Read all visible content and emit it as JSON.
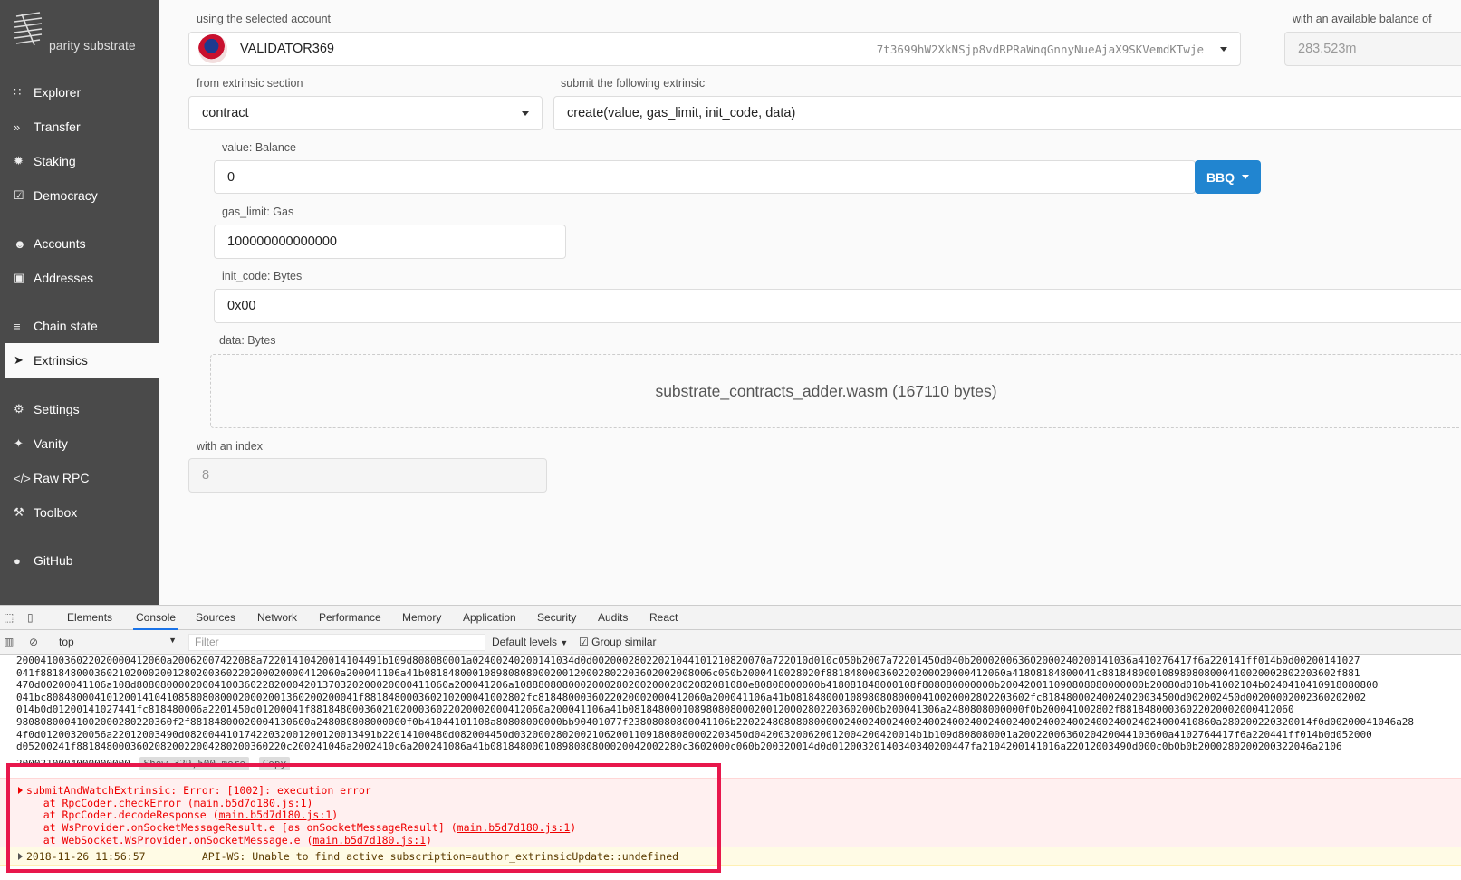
{
  "sidebar": {
    "logo_text": "parity substrate",
    "items": [
      {
        "label": "Explorer",
        "icon": "grid-icon"
      },
      {
        "label": "Transfer",
        "icon": "double-chevron-icon"
      },
      {
        "label": "Staking",
        "icon": "certificate-icon"
      },
      {
        "label": "Democracy",
        "icon": "calendar-check-icon"
      },
      {
        "label": "Accounts",
        "icon": "users-icon"
      },
      {
        "label": "Addresses",
        "icon": "address-book-icon"
      },
      {
        "label": "Chain state",
        "icon": "database-icon"
      },
      {
        "label": "Extrinsics",
        "icon": "paper-plane-icon"
      },
      {
        "label": "Settings",
        "icon": "gears-icon"
      },
      {
        "label": "Vanity",
        "icon": "wand-icon"
      },
      {
        "label": "Raw RPC",
        "icon": "code-icon"
      },
      {
        "label": "Toolbox",
        "icon": "wrench-icon"
      },
      {
        "label": "GitHub",
        "icon": "github-icon"
      }
    ]
  },
  "form": {
    "account_label": "using the selected account",
    "account_name": "VALIDATOR369",
    "account_address": "7t3699hW2XkNSjp8vdRPRaWnqGnnyNueAjaX9SKVemdKTwje",
    "balance_label": "with an available balance of",
    "balance_value": "283.523m",
    "section_label": "from extrinsic section",
    "section_value": "contract",
    "extrinsic_label": "submit the following extrinsic",
    "extrinsic_value": "create(value, gas_limit, init_code, data)",
    "value_label": "value: Balance",
    "value_value": "0",
    "unit_button": "BBQ",
    "gas_label": "gas_limit: Gas",
    "gas_value": "100000000000000",
    "init_label": "init_code: Bytes",
    "init_value": "0x00",
    "data_label": "data: Bytes",
    "data_file": "substrate_contracts_adder.wasm (167110 bytes)",
    "index_label": "with an index",
    "index_value": "8"
  },
  "devtools": {
    "tabs": [
      "Elements",
      "Console",
      "Sources",
      "Network",
      "Performance",
      "Memory",
      "Application",
      "Security",
      "Audits",
      "React"
    ],
    "context": "top",
    "filter_placeholder": "Filter",
    "levels": "Default levels",
    "group_similar": "Group similar",
    "log_lines": [
      "2000410036022020000412060a20062007422088a72201410420014104491b109d808080001a02400240200141034d0d00200028022021044101210820070a722010d010c050b2007a72201450d040b200020063602000240200141036a410276417f6a220141ff014b0d00200141027",
      "041f88184800036021020002001280200360220200020000412060a200041106a41b081848000108980808000200120002802203602002008006c050b2000410028020f881848000360220200020000412060a41808184800041c881848000108980808000410020002802203602f881",
      "470d00200041106a108d8080800002000410036022820004201370320200020000411060a200041206a108880808000200028020020002802082081080e80808000000b418081848000108f808080000000b200420011090808080000000b20080d010b41002104b0240410410918080800",
      "041bc8084800041012001410410858080800020002001360200200041f881848000360210200041002802fc8184800036022020002000412060a200041106a41b0818480001089808080000410020002802203602fc81848000240024020034500d002002450d00200002002360202002",
      "014b0d01200141027441fc818480006a2201450d01200041f881848000360210200036022020002000412060a200041106a41b081848000108980808000200120002802203602000b200041306a2480808000000f0b200041002802f88184800036022020002000412060",
      "98080800041002000280220360f2f88184800020004130600a248080808000000f0b41044101108a80808000000bb90401077f23808080800041106b22022480808080000024002400240024002400240024002400240024002400240024024000410860a280200220320014f0d00200041046a28",
      "4f0d01200320056a22012003490d08200441017422032001200120013491b22014100480d082004450d032000280200210620011091808080002203450d042003200620012004200420014b1b109d808080001a2002200636020420044103600a4102764417f6a220441ff014b0d052000",
      "d05200241f88184800036020820022004280200360220c200241046a2002410c6a200241086a41b08184800010898080800020042002280c3602000c060b200320014d0d01200320140340340200447fa2104200141016a22012003490d000c0b0b0b2000280200200322046a2106"
    ],
    "show_more_prefix": "2000210004000000000",
    "show_more": "Show 329,500 more",
    "copy": "Copy",
    "error_title": "submitAndWatchExtrinsic: Error: [1002]: execution error",
    "stack": [
      {
        "prefix": "    at RpcCoder.checkError (",
        "link": "main.b5d7d180.js:1",
        "suffix": ")"
      },
      {
        "prefix": "    at RpcCoder.decodeResponse (",
        "link": "main.b5d7d180.js:1",
        "suffix": ")"
      },
      {
        "prefix": "    at WsProvider.onSocketMessageResult.e [as onSocketMessageResult] (",
        "link": "main.b5d7d180.js:1",
        "suffix": ")"
      },
      {
        "prefix": "    at WebSocket.WsProvider.onSocketMessage.e (",
        "link": "main.b5d7d180.js:1",
        "suffix": ")"
      }
    ],
    "warning": "2018-11-26 11:56:57         API-WS: Unable to find active subscription=author_extrinsicUpdate::undefined"
  },
  "colors": {
    "sidebar_bg": "#4a4a4a",
    "accent": "#2185d0",
    "highlight": "#e8174c",
    "error": "#e00000"
  }
}
